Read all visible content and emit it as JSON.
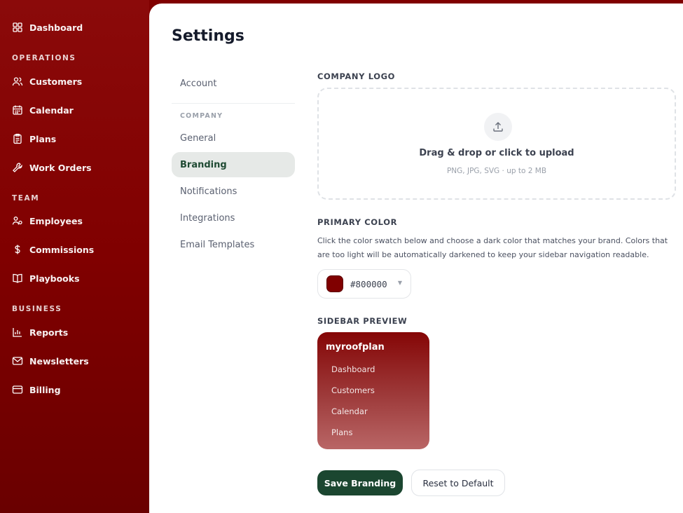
{
  "sidebar": {
    "dashboard": "Dashboard",
    "sections": {
      "operations": "OPERATIONS",
      "team": "TEAM",
      "business": "BUSINESS"
    },
    "items": {
      "customers": "Customers",
      "calendar": "Calendar",
      "plans": "Plans",
      "work_orders": "Work Orders",
      "employees": "Employees",
      "commissions": "Commissions",
      "playbooks": "Playbooks",
      "reports": "Reports",
      "newsletters": "Newsletters",
      "billing": "Billing"
    }
  },
  "page": {
    "title": "Settings"
  },
  "settings_nav": {
    "account": "Account",
    "company_section": "COMPANY",
    "general": "General",
    "branding": "Branding",
    "notifications": "Notifications",
    "integrations": "Integrations",
    "email_templates": "Email Templates",
    "active": "branding"
  },
  "branding": {
    "logo_label": "COMPANY LOGO",
    "upload_title": "Drag & drop or click to upload",
    "upload_hint": "PNG, JPG, SVG · up to 2 MB",
    "color_label": "PRIMARY COLOR",
    "color_help": "Click the color swatch below and choose a dark color that matches your brand. Colors that are too light will be automatically darkened to keep your sidebar navigation readable.",
    "color_value": "#800000",
    "preview_label": "SIDEBAR PREVIEW",
    "preview": {
      "brand": "myroofplan",
      "items": [
        "Dashboard",
        "Customers",
        "Calendar",
        "Plans"
      ]
    },
    "save_label": "Save Branding",
    "reset_label": "Reset to Default"
  },
  "colors": {
    "brand": "#800000",
    "primary_button": "#1b4630",
    "active_nav_bg": "#e6e9e7"
  },
  "icons": {
    "dashboard": "grid-icon",
    "customers": "users-icon",
    "calendar": "calendar-icon",
    "plans": "clipboard-icon",
    "work_orders": "wrench-icon",
    "employees": "user-group-icon",
    "commissions": "dollar-icon",
    "playbooks": "book-icon",
    "reports": "bar-chart-icon",
    "newsletters": "mail-icon",
    "billing": "credit-card-icon",
    "upload": "upload-icon"
  }
}
